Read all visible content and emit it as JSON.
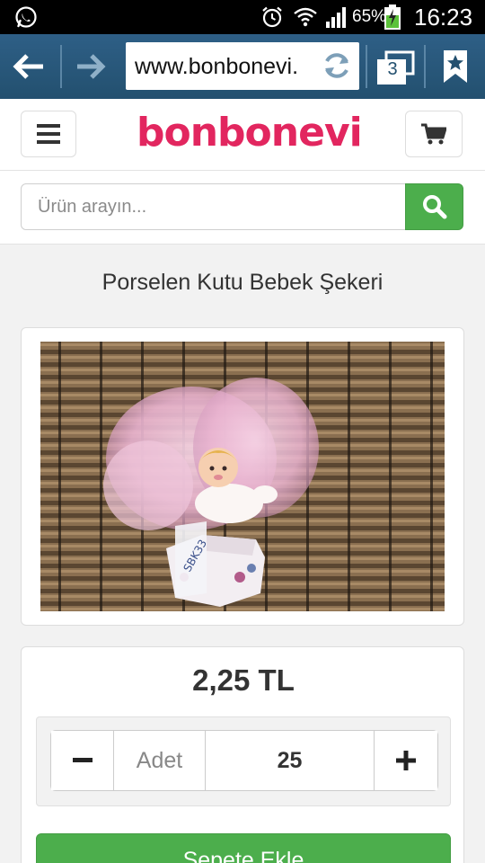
{
  "status_bar": {
    "battery_percent": "65%",
    "time": "16:23",
    "icons": [
      "whatsapp-icon",
      "alarm-icon",
      "wifi-icon",
      "signal-icon",
      "battery-charging-icon"
    ]
  },
  "browser": {
    "url": "www.bonbonevi.",
    "tab_count": "3",
    "icons": [
      "back-arrow-icon",
      "forward-arrow-icon",
      "reload-icon",
      "tabs-icon",
      "bookmark-star-icon"
    ]
  },
  "site": {
    "logo_text": "bonbonevi",
    "brand_color": "#e2265f",
    "search_placeholder": "Ürün arayın...",
    "accent_green": "#4cae4c"
  },
  "product": {
    "title": "Porselen Kutu Bebek Şekeri",
    "price": "2,25 TL",
    "quantity_label": "Adet",
    "quantity_value": "25",
    "add_to_cart_label": "Sepete Ekle",
    "image_tag_text": "SBK33"
  }
}
